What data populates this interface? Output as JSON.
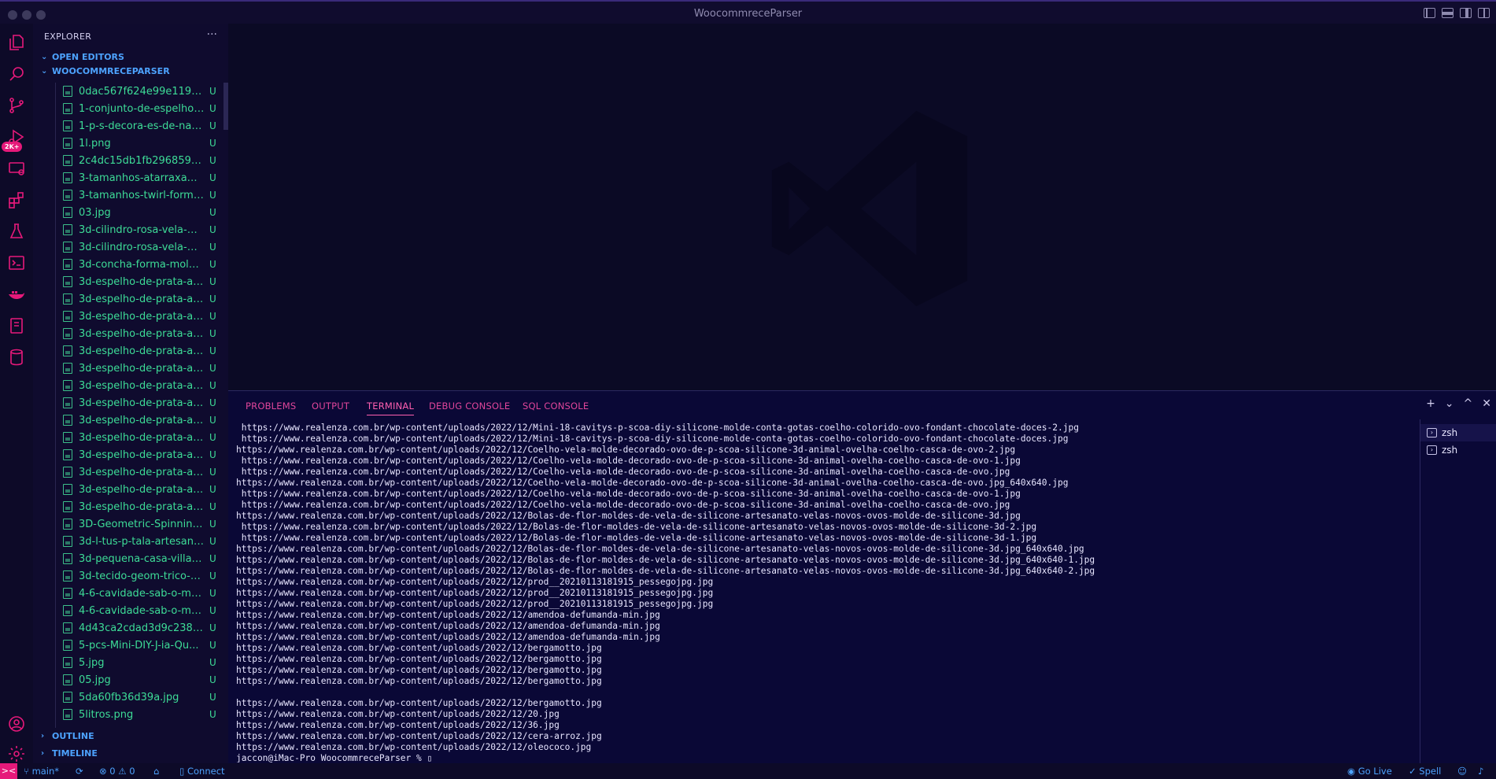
{
  "window": {
    "title": "WoocommreceParser"
  },
  "activity": {
    "source_control_badge": "2K+"
  },
  "sidebar": {
    "header": "EXPLORER",
    "more": "···",
    "sections": {
      "open_editors": "OPEN EDITORS",
      "project": "WOOCOMMRECEPARSER",
      "outline": "OUTLINE",
      "timeline": "TIMELINE"
    },
    "files": [
      {
        "name": "0dac567f624e99e11913...",
        "status": "U"
      },
      {
        "name": "1-conjunto-de-espelho-...",
        "status": "U"
      },
      {
        "name": "1-p-s-decora-es-de-nat...",
        "status": "U"
      },
      {
        "name": "1l.png",
        "status": "U"
      },
      {
        "name": "2c4dc15db1fb29685962...",
        "status": "U"
      },
      {
        "name": "3-tamanhos-atarraxame...",
        "status": "U"
      },
      {
        "name": "3-tamanhos-twirl-forma...",
        "status": "U"
      },
      {
        "name": "03.jpg",
        "status": "U"
      },
      {
        "name": "3d-cilindro-rosa-vela-m...",
        "status": "U"
      },
      {
        "name": "3d-cilindro-rosa-vela-m...",
        "status": "U"
      },
      {
        "name": "3d-concha-forma-molde...",
        "status": "U"
      },
      {
        "name": "3d-espelho-de-prata-art...",
        "status": "U"
      },
      {
        "name": "3d-espelho-de-prata-art...",
        "status": "U"
      },
      {
        "name": "3d-espelho-de-prata-art...",
        "status": "U"
      },
      {
        "name": "3d-espelho-de-prata-art...",
        "status": "U"
      },
      {
        "name": "3d-espelho-de-prata-art...",
        "status": "U"
      },
      {
        "name": "3d-espelho-de-prata-art...",
        "status": "U"
      },
      {
        "name": "3d-espelho-de-prata-art...",
        "status": "U"
      },
      {
        "name": "3d-espelho-de-prata-art...",
        "status": "U"
      },
      {
        "name": "3d-espelho-de-prata-art...",
        "status": "U"
      },
      {
        "name": "3d-espelho-de-prata-art...",
        "status": "U"
      },
      {
        "name": "3d-espelho-de-prata-art...",
        "status": "U"
      },
      {
        "name": "3d-espelho-de-prata-art...",
        "status": "U"
      },
      {
        "name": "3d-espelho-de-prata-art...",
        "status": "U"
      },
      {
        "name": "3d-espelho-de-prata-art...",
        "status": "U"
      },
      {
        "name": "3D-Geometric-Spinning-...",
        "status": "U"
      },
      {
        "name": "3d-l-tus-p-tala-artesana...",
        "status": "U"
      },
      {
        "name": "3d-pequena-casa-villa-c...",
        "status": "U"
      },
      {
        "name": "3d-tecido-geom-trico-q...",
        "status": "U"
      },
      {
        "name": "4-6-cavidade-sab-o-mo...",
        "status": "U"
      },
      {
        "name": "4-6-cavidade-sab-o-mo...",
        "status": "U"
      },
      {
        "name": "4d43ca2cdad3d9c238f...",
        "status": "U"
      },
      {
        "name": "5-pcs-Mini-DIY-J-ia-Qu...",
        "status": "U"
      },
      {
        "name": "5.jpg",
        "status": "U"
      },
      {
        "name": "05.jpg",
        "status": "U"
      },
      {
        "name": "5da60fb36d39a.jpg",
        "status": "U"
      },
      {
        "name": "5litros.png",
        "status": "U"
      }
    ]
  },
  "panel": {
    "tabs": [
      "PROBLEMS",
      "OUTPUT",
      "TERMINAL",
      "DEBUG CONSOLE",
      "SQL CONSOLE"
    ],
    "actions": {
      "add": "+",
      "dropdown": "⌄",
      "maximize": "^",
      "close": "✕"
    },
    "terminals": [
      "zsh",
      "zsh"
    ],
    "terminal_lines": [
      " https://www.realenza.com.br/wp-content/uploads/2022/12/Mini-18-cavitys-p-scoa-diy-silicone-molde-conta-gotas-coelho-colorido-ovo-fondant-chocolate-doces-2.jpg",
      " https://www.realenza.com.br/wp-content/uploads/2022/12/Mini-18-cavitys-p-scoa-diy-silicone-molde-conta-gotas-coelho-colorido-ovo-fondant-chocolate-doces.jpg",
      "https://www.realenza.com.br/wp-content/uploads/2022/12/Coelho-vela-molde-decorado-ovo-de-p-scoa-silicone-3d-animal-ovelha-coelho-casca-de-ovo-2.jpg",
      " https://www.realenza.com.br/wp-content/uploads/2022/12/Coelho-vela-molde-decorado-ovo-de-p-scoa-silicone-3d-animal-ovelha-coelho-casca-de-ovo-1.jpg",
      " https://www.realenza.com.br/wp-content/uploads/2022/12/Coelho-vela-molde-decorado-ovo-de-p-scoa-silicone-3d-animal-ovelha-coelho-casca-de-ovo.jpg",
      "https://www.realenza.com.br/wp-content/uploads/2022/12/Coelho-vela-molde-decorado-ovo-de-p-scoa-silicone-3d-animal-ovelha-coelho-casca-de-ovo.jpg_640x640.jpg",
      " https://www.realenza.com.br/wp-content/uploads/2022/12/Coelho-vela-molde-decorado-ovo-de-p-scoa-silicone-3d-animal-ovelha-coelho-casca-de-ovo-1.jpg",
      " https://www.realenza.com.br/wp-content/uploads/2022/12/Coelho-vela-molde-decorado-ovo-de-p-scoa-silicone-3d-animal-ovelha-coelho-casca-de-ovo.jpg",
      "https://www.realenza.com.br/wp-content/uploads/2022/12/Bolas-de-flor-moldes-de-vela-de-silicone-artesanato-velas-novos-ovos-molde-de-silicone-3d.jpg",
      " https://www.realenza.com.br/wp-content/uploads/2022/12/Bolas-de-flor-moldes-de-vela-de-silicone-artesanato-velas-novos-ovos-molde-de-silicone-3d-2.jpg",
      " https://www.realenza.com.br/wp-content/uploads/2022/12/Bolas-de-flor-moldes-de-vela-de-silicone-artesanato-velas-novos-ovos-molde-de-silicone-3d-1.jpg",
      "https://www.realenza.com.br/wp-content/uploads/2022/12/Bolas-de-flor-moldes-de-vela-de-silicone-artesanato-velas-novos-ovos-molde-de-silicone-3d.jpg_640x640.jpg",
      "https://www.realenza.com.br/wp-content/uploads/2022/12/Bolas-de-flor-moldes-de-vela-de-silicone-artesanato-velas-novos-ovos-molde-de-silicone-3d.jpg_640x640-1.jpg",
      "https://www.realenza.com.br/wp-content/uploads/2022/12/Bolas-de-flor-moldes-de-vela-de-silicone-artesanato-velas-novos-ovos-molde-de-silicone-3d.jpg_640x640-2.jpg",
      "https://www.realenza.com.br/wp-content/uploads/2022/12/prod__20210113181915_pessegojpg.jpg",
      "https://www.realenza.com.br/wp-content/uploads/2022/12/prod__20210113181915_pessegojpg.jpg",
      "https://www.realenza.com.br/wp-content/uploads/2022/12/prod__20210113181915_pessegojpg.jpg",
      "https://www.realenza.com.br/wp-content/uploads/2022/12/amendoa-defumanda-min.jpg",
      "https://www.realenza.com.br/wp-content/uploads/2022/12/amendoa-defumanda-min.jpg",
      "https://www.realenza.com.br/wp-content/uploads/2022/12/amendoa-defumanda-min.jpg",
      "https://www.realenza.com.br/wp-content/uploads/2022/12/bergamotto.jpg",
      "https://www.realenza.com.br/wp-content/uploads/2022/12/bergamotto.jpg",
      "https://www.realenza.com.br/wp-content/uploads/2022/12/bergamotto.jpg",
      "https://www.realenza.com.br/wp-content/uploads/2022/12/bergamotto.jpg",
      "",
      "https://www.realenza.com.br/wp-content/uploads/2022/12/bergamotto.jpg",
      "https://www.realenza.com.br/wp-content/uploads/2022/12/20.jpg",
      "https://www.realenza.com.br/wp-content/uploads/2022/12/36.jpg",
      "https://www.realenza.com.br/wp-content/uploads/2022/12/cera-arroz.jpg",
      "https://www.realenza.com.br/wp-content/uploads/2022/12/oleococo.jpg",
      "jaccon@iMac-Pro WoocommreceParser % ▯"
    ]
  },
  "statusbar": {
    "remote": "><",
    "branch": "main*",
    "sync": "⟳",
    "problems": "⊗ 0 ⚠ 0",
    "home": "⌂",
    "connect": "Connect",
    "go_live": "Go Live",
    "spell": "Spell"
  },
  "colors": {
    "accent_pink": "#e6197a",
    "file_green": "#3ddc97",
    "link_blue": "#4da3ff",
    "panel_bg": "#0a0836"
  }
}
